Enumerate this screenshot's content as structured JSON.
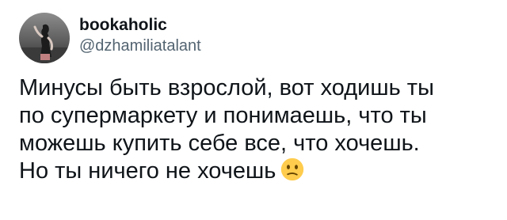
{
  "tweet": {
    "author": {
      "display_name": "bookaholic",
      "handle": "@dzhamiliatalant",
      "avatar_icon": "profile-photo-avatar"
    },
    "text_lines": [
      "Минусы быть взрослой, вот ходишь ты",
      "по супермаркету и понимаешь, что ты",
      "можешь купить себе все, что хочешь.",
      "Но ты ничего не хочешь"
    ],
    "trailing_emoji": "confused-face-icon",
    "colors": {
      "text": "#0f1419",
      "secondary_text": "#536471",
      "background": "#ffffff",
      "emoji_yellow": "#ffcc4d"
    }
  }
}
